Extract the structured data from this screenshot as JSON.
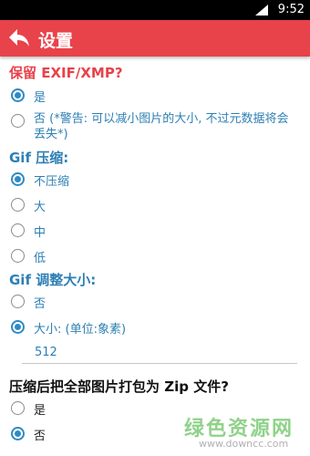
{
  "status_bar": {
    "time": "9:52"
  },
  "action_bar": {
    "title": "设置",
    "back_icon": "back-arrow-icon"
  },
  "colors": {
    "action_bar": "#e8424a",
    "section_red": "#e8424a",
    "section_blue": "#2d7fb4",
    "radio_checked": "#2e8bc4",
    "watermark": "#8fd28a"
  },
  "sections": {
    "exif": {
      "title": "保留 EXIF/XMP?",
      "options": [
        {
          "label": "是",
          "checked": true
        },
        {
          "label": "否 (*警告: 可以减小图片的大小, 不过元数据将会丢失*)",
          "checked": false
        }
      ]
    },
    "gif_compress": {
      "title": "Gif 压缩:",
      "options": [
        {
          "label": "不压缩",
          "checked": true
        },
        {
          "label": "大",
          "checked": false
        },
        {
          "label": "中",
          "checked": false
        },
        {
          "label": "低",
          "checked": false
        }
      ]
    },
    "gif_resize": {
      "title": "Gif 调整大小:",
      "options": [
        {
          "label": "否",
          "checked": false
        },
        {
          "label": "大小: (单位:象素)",
          "checked": true
        }
      ],
      "size_value": "512"
    },
    "zip": {
      "title": "压缩后把全部图片打包为 Zip 文件?",
      "options": [
        {
          "label": "是",
          "checked": false
        },
        {
          "label": "否",
          "checked": true
        }
      ]
    }
  },
  "watermark": {
    "line1": "绿色资源网",
    "line2": "www.downcc.com"
  }
}
